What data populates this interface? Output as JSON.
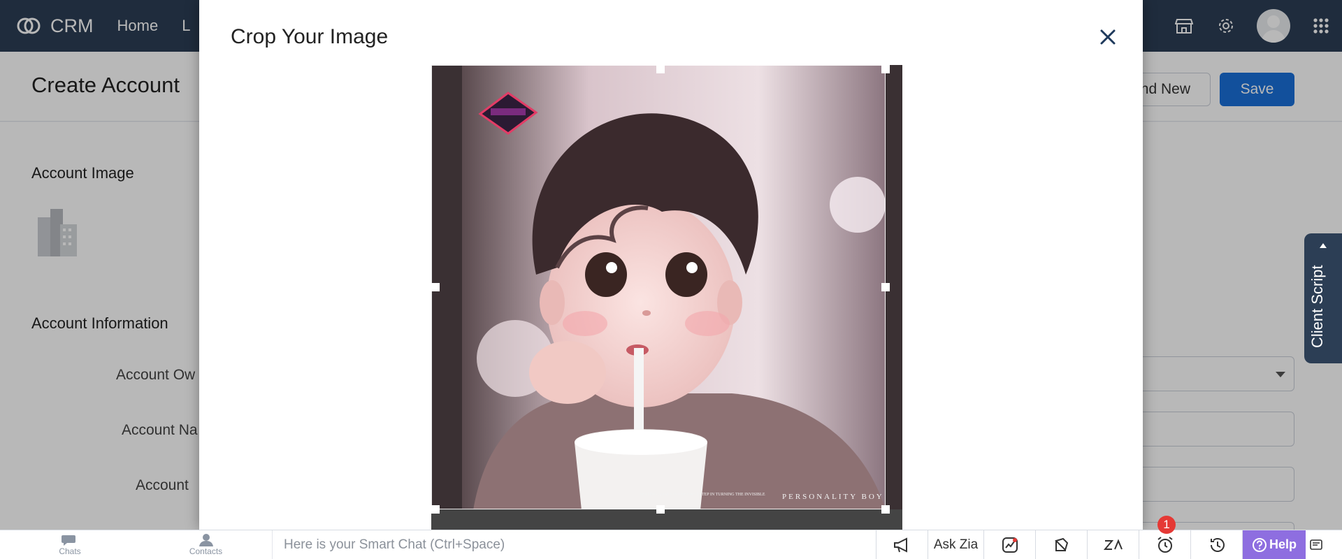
{
  "nav": {
    "brand": "CRM",
    "items": [
      "Home",
      "L"
    ]
  },
  "page": {
    "title": "Create Account",
    "save_and_new_label": "nd New",
    "save_label": "Save"
  },
  "form": {
    "account_image_title": "Account Image",
    "account_information_title": "Account Information",
    "fields": [
      "Account Ow",
      "Account Na",
      "Account"
    ]
  },
  "client_script": {
    "label": "Client Script"
  },
  "modal": {
    "title": "Crop Your Image",
    "image_watermark": "PERSONALITY BOY",
    "image_tagline": "SETTING GOALS IS THE FIRST STEP IN TURNING THE INVISIBLE"
  },
  "bottombar": {
    "chats_label": "Chats",
    "contacts_label": "Contacts",
    "smartchat_placeholder": "Here is your Smart Chat (Ctrl+Space)",
    "ask_zia_label": "Ask Zia",
    "reminder_count": "1",
    "help_label": "Help"
  },
  "icons": {
    "announce": "megaphone-icon",
    "signals": "signals-icon",
    "recent": "history-icon",
    "alarm": "alarm-icon"
  }
}
